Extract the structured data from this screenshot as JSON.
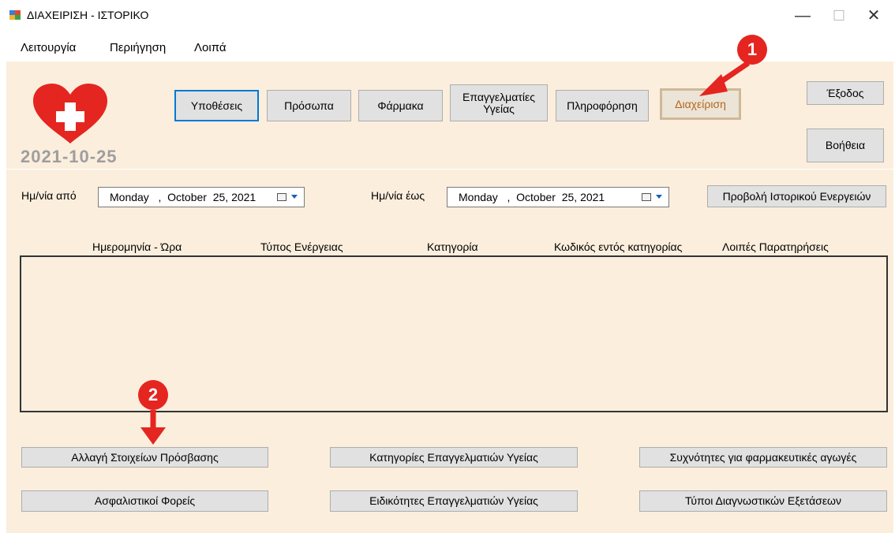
{
  "window": {
    "title": "ΔΙΑΧΕΙΡΙΣΗ - ΙΣΤΟΡΙΚΟ",
    "minimize": "—",
    "maximize": "☐",
    "close": "✕"
  },
  "menu": [
    "Λειτουργία",
    "Περιήγηση",
    "Λοιπά"
  ],
  "header": {
    "date": "2021-10-25",
    "nav_buttons": [
      "Υποθέσεις",
      "Πρόσωπα",
      "Φάρμακα",
      "Επαγγελματίες Υγείας",
      "Πληροφόρηση",
      "Διαχείριση"
    ],
    "exit": "Έξοδος",
    "help": "Βοήθεια"
  },
  "filters": {
    "from_label": "Ημ/νία από",
    "from_value": "Monday   ,  October  25, 2021",
    "to_label": "Ημ/νία έως",
    "to_value": "Monday   ,  October  25, 2021",
    "history_button": "Προβολή Ιστορικού Ενεργειών"
  },
  "table": {
    "columns": [
      "Ημερομηνία - Ώρα",
      "Τύπος Ενέργειας",
      "Κατηγορία",
      "Κωδικός εντός κατηγορίας",
      "Λοιπές Παρατηρήσεις"
    ],
    "rows": []
  },
  "bottom_buttons": [
    "Αλλαγή Στοιχείων Πρόσβασης",
    "Κατηγορίες Επαγγελματιών Υγείας",
    "Συχνότητες για φαρμακευτικές αγωγές",
    "Ασφαλιστικοί Φορείς",
    "Ειδικότητες Επαγγελματιών Υγείας",
    "Τύποι Διαγνωστικών Εξετάσεων"
  ],
  "annotations": [
    "1",
    "2"
  ],
  "colors": {
    "panel_bg": "#fbeedd",
    "accent_blue": "#0078d7",
    "heart_red": "#e52520",
    "annotation_red": "#e52520"
  },
  "icons": [
    "app-icon",
    "heart-cross-logo",
    "calendar-icon",
    "dropdown-arrow-icon",
    "red-arrow"
  ]
}
